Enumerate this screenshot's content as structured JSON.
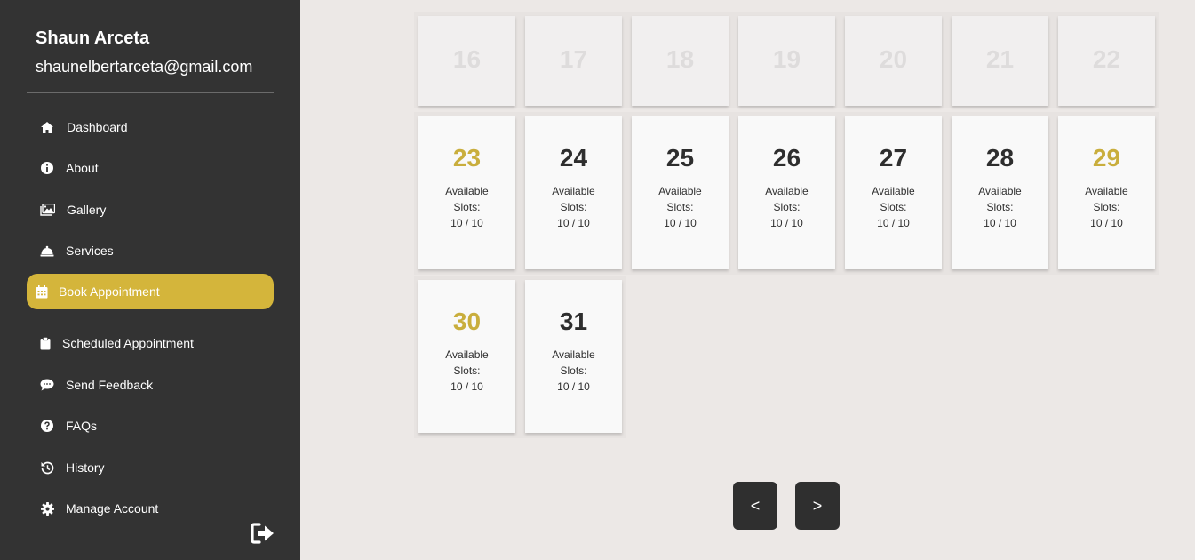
{
  "user": {
    "name": "Shaun Arceta",
    "email": "shaunelbertarceta@gmail.com"
  },
  "nav": [
    {
      "label": "Dashboard",
      "icon": "home-icon"
    },
    {
      "label": "About",
      "icon": "info-icon"
    },
    {
      "label": "Gallery",
      "icon": "image-icon"
    },
    {
      "label": "Services",
      "icon": "bell-icon"
    },
    {
      "label": "Book Appointment",
      "icon": "calendar-icon",
      "active": true
    },
    {
      "label": "Scheduled Appointment",
      "icon": "clipboard-icon"
    },
    {
      "label": "Send Feedback",
      "icon": "chat-icon"
    },
    {
      "label": "FAQs",
      "icon": "question-icon"
    },
    {
      "label": "History",
      "icon": "history-icon"
    },
    {
      "label": "Manage Account",
      "icon": "gear-icon"
    }
  ],
  "calendar": {
    "disabled_days": [
      "16",
      "17",
      "18",
      "19",
      "20",
      "21",
      "22"
    ],
    "days": [
      {
        "day": "23",
        "available": "Available",
        "slots": "Slots:",
        "count": "10 / 10"
      },
      {
        "day": "24",
        "available": "Available",
        "slots": "Slots:",
        "count": "10 / 10"
      },
      {
        "day": "25",
        "available": "Available",
        "slots": "Slots:",
        "count": "10 / 10"
      },
      {
        "day": "26",
        "available": "Available",
        "slots": "Slots:",
        "count": "10 / 10"
      },
      {
        "day": "27",
        "available": "Available",
        "slots": "Slots:",
        "count": "10 / 10"
      },
      {
        "day": "28",
        "available": "Available",
        "slots": "Slots:",
        "count": "10 / 10"
      },
      {
        "day": "29",
        "available": "Available",
        "slots": "Slots:",
        "count": "10 / 10"
      },
      {
        "day": "30",
        "available": "Available",
        "slots": "Slots:",
        "count": "10 / 10"
      },
      {
        "day": "31",
        "available": "Available",
        "slots": "Slots:",
        "count": "10 / 10"
      }
    ]
  },
  "pager": {
    "prev": "<",
    "next": ">"
  },
  "colors": {
    "accent": "#d4b53b",
    "sidebar": "#333333",
    "weekend_day": "#c9ae3d"
  }
}
